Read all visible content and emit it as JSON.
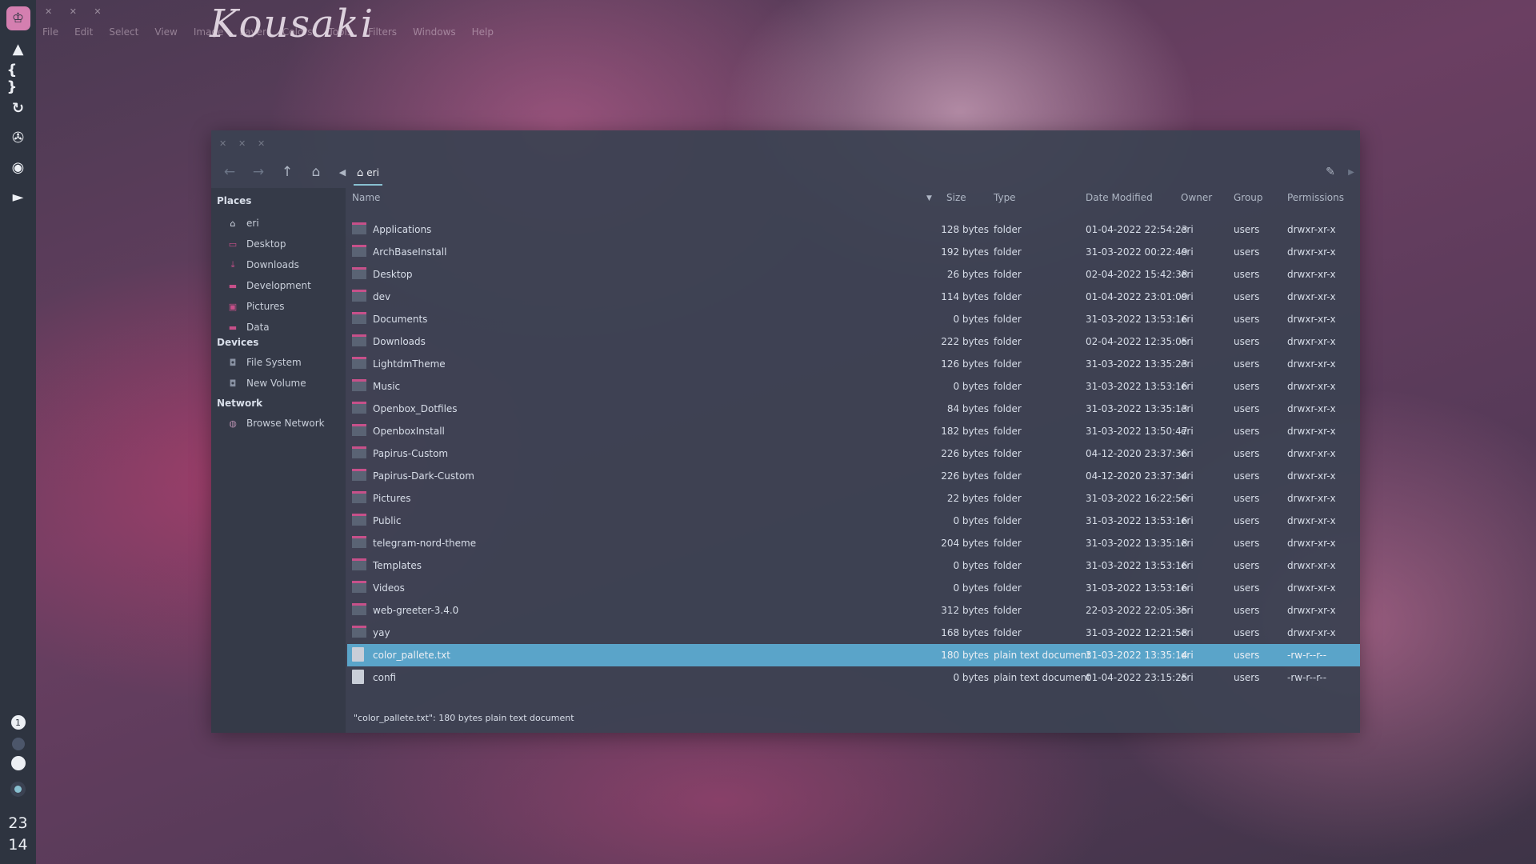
{
  "top_menu": [
    "File",
    "Edit",
    "Select",
    "View",
    "Image",
    "Layer",
    "Colors",
    "Tools",
    "Filters",
    "Windows",
    "Help"
  ],
  "signature": "Kousaki",
  "dock": {
    "icons": [
      "crown-icon",
      "mountain-icon",
      "braces-icon",
      "refresh-icon",
      "aperture-icon",
      "sound-icon",
      "play-icon"
    ],
    "workspace_number": "1",
    "clock_hour": "23",
    "clock_minute": "14"
  },
  "toolbar": {
    "breadcrumb": "eri",
    "icons": [
      "back-arrow-icon",
      "forward-arrow-icon",
      "up-arrow-icon",
      "home-icon",
      "left-chevron-icon",
      "edit-icon",
      "right-chevron-icon"
    ]
  },
  "sidebar": {
    "places_heading": "Places",
    "places": [
      {
        "label": "eri",
        "icon": "home-icon"
      },
      {
        "label": "Desktop",
        "icon": "desktop-folder-icon"
      },
      {
        "label": "Downloads",
        "icon": "downloads-folder-icon"
      },
      {
        "label": "Development",
        "icon": "folder-icon"
      },
      {
        "label": "Pictures",
        "icon": "pictures-folder-icon"
      },
      {
        "label": "Data",
        "icon": "folder-icon"
      }
    ],
    "devices_heading": "Devices",
    "devices": [
      {
        "label": "File System",
        "icon": "drive-icon"
      },
      {
        "label": "New Volume",
        "icon": "drive-icon"
      }
    ],
    "network_heading": "Network",
    "network": [
      {
        "label": "Browse Network",
        "icon": "network-icon"
      }
    ]
  },
  "columns": {
    "name": "Name",
    "size": "Size",
    "type": "Type",
    "date": "Date Modified",
    "owner": "Owner",
    "group": "Group",
    "permissions": "Permissions"
  },
  "files": [
    {
      "name": "Applications",
      "size": "128 bytes",
      "type": "folder",
      "date": "01-04-2022 22:54:23",
      "owner": "eri",
      "group": "users",
      "perm": "drwxr-xr-x",
      "kind": "folder"
    },
    {
      "name": "ArchBaseInstall",
      "size": "192 bytes",
      "type": "folder",
      "date": "31-03-2022 00:22:49",
      "owner": "eri",
      "group": "users",
      "perm": "drwxr-xr-x",
      "kind": "folder"
    },
    {
      "name": "Desktop",
      "size": "26 bytes",
      "type": "folder",
      "date": "02-04-2022 15:42:38",
      "owner": "eri",
      "group": "users",
      "perm": "drwxr-xr-x",
      "kind": "folder"
    },
    {
      "name": "dev",
      "size": "114 bytes",
      "type": "folder",
      "date": "01-04-2022 23:01:09",
      "owner": "eri",
      "group": "users",
      "perm": "drwxr-xr-x",
      "kind": "folder"
    },
    {
      "name": "Documents",
      "size": "0 bytes",
      "type": "folder",
      "date": "31-03-2022 13:53:16",
      "owner": "eri",
      "group": "users",
      "perm": "drwxr-xr-x",
      "kind": "folder"
    },
    {
      "name": "Downloads",
      "size": "222 bytes",
      "type": "folder",
      "date": "02-04-2022 12:35:05",
      "owner": "eri",
      "group": "users",
      "perm": "drwxr-xr-x",
      "kind": "folder"
    },
    {
      "name": "LightdmTheme",
      "size": "126 bytes",
      "type": "folder",
      "date": "31-03-2022 13:35:23",
      "owner": "eri",
      "group": "users",
      "perm": "drwxr-xr-x",
      "kind": "folder"
    },
    {
      "name": "Music",
      "size": "0 bytes",
      "type": "folder",
      "date": "31-03-2022 13:53:16",
      "owner": "eri",
      "group": "users",
      "perm": "drwxr-xr-x",
      "kind": "folder"
    },
    {
      "name": "Openbox_Dotfiles",
      "size": "84 bytes",
      "type": "folder",
      "date": "31-03-2022 13:35:13",
      "owner": "eri",
      "group": "users",
      "perm": "drwxr-xr-x",
      "kind": "folder"
    },
    {
      "name": "OpenboxInstall",
      "size": "182 bytes",
      "type": "folder",
      "date": "31-03-2022 13:50:47",
      "owner": "eri",
      "group": "users",
      "perm": "drwxr-xr-x",
      "kind": "folder"
    },
    {
      "name": "Papirus-Custom",
      "size": "226 bytes",
      "type": "folder",
      "date": "04-12-2020 23:37:36",
      "owner": "eri",
      "group": "users",
      "perm": "drwxr-xr-x",
      "kind": "folder"
    },
    {
      "name": "Papirus-Dark-Custom",
      "size": "226 bytes",
      "type": "folder",
      "date": "04-12-2020 23:37:34",
      "owner": "eri",
      "group": "users",
      "perm": "drwxr-xr-x",
      "kind": "folder"
    },
    {
      "name": "Pictures",
      "size": "22 bytes",
      "type": "folder",
      "date": "31-03-2022 16:22:56",
      "owner": "eri",
      "group": "users",
      "perm": "drwxr-xr-x",
      "kind": "folder"
    },
    {
      "name": "Public",
      "size": "0 bytes",
      "type": "folder",
      "date": "31-03-2022 13:53:16",
      "owner": "eri",
      "group": "users",
      "perm": "drwxr-xr-x",
      "kind": "folder"
    },
    {
      "name": "telegram-nord-theme",
      "size": "204 bytes",
      "type": "folder",
      "date": "31-03-2022 13:35:18",
      "owner": "eri",
      "group": "users",
      "perm": "drwxr-xr-x",
      "kind": "folder"
    },
    {
      "name": "Templates",
      "size": "0 bytes",
      "type": "folder",
      "date": "31-03-2022 13:53:16",
      "owner": "eri",
      "group": "users",
      "perm": "drwxr-xr-x",
      "kind": "folder"
    },
    {
      "name": "Videos",
      "size": "0 bytes",
      "type": "folder",
      "date": "31-03-2022 13:53:16",
      "owner": "eri",
      "group": "users",
      "perm": "drwxr-xr-x",
      "kind": "folder"
    },
    {
      "name": "web-greeter-3.4.0",
      "size": "312 bytes",
      "type": "folder",
      "date": "22-03-2022 22:05:35",
      "owner": "eri",
      "group": "users",
      "perm": "drwxr-xr-x",
      "kind": "folder"
    },
    {
      "name": "yay",
      "size": "168 bytes",
      "type": "folder",
      "date": "31-03-2022 12:21:58",
      "owner": "eri",
      "group": "users",
      "perm": "drwxr-xr-x",
      "kind": "folder"
    },
    {
      "name": "color_pallete.txt",
      "size": "180 bytes",
      "type": "plain text document",
      "date": "31-03-2022 13:35:14",
      "owner": "eri",
      "group": "users",
      "perm": "-rw-r--r--",
      "kind": "doc",
      "selected": true
    },
    {
      "name": "confi",
      "size": "0 bytes",
      "type": "plain text document",
      "date": "01-04-2022 23:15:25",
      "owner": "eri",
      "group": "users",
      "perm": "-rw-r--r--",
      "kind": "doc"
    }
  ],
  "status_text": "\"color_pallete.txt\": 180 bytes plain text document",
  "colors": {
    "accent": "#88c0d0",
    "selection": "#5aa4c9",
    "folder_accent": "#c7508a",
    "dock": "#2e3440"
  }
}
